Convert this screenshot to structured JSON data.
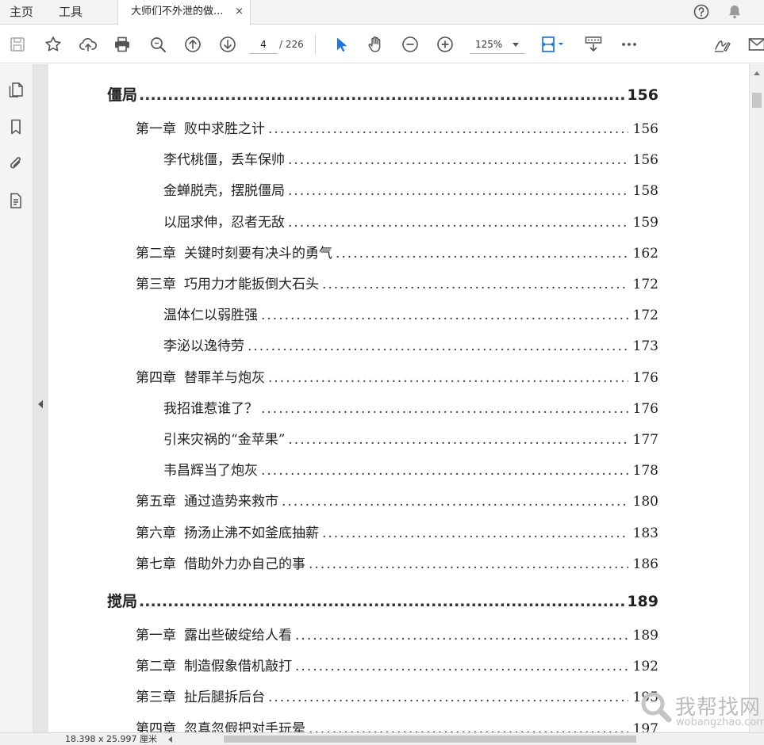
{
  "tabs": {
    "home": "主页",
    "tools": "工具",
    "document_title": "大师们不外泄的做...",
    "close_glyph": "×"
  },
  "toolbar": {
    "current_page": "4",
    "total_pages": "/ 226",
    "zoom": "125%",
    "icons": [
      "save-icon",
      "bookmark-star-icon",
      "cloud-upload-icon",
      "print-icon",
      "zoom-search-icon",
      "page-up-icon",
      "page-down-icon",
      "select-cursor-icon",
      "hand-tool-icon",
      "zoom-out-icon",
      "zoom-in-icon",
      "fit-page-icon",
      "scroll-mode-icon",
      "more-icon",
      "sign-icon",
      "mail-icon"
    ]
  },
  "left_rail": {
    "icons": [
      "page-thumbnails-icon",
      "bookmarks-icon",
      "attachments-icon",
      "document-properties-icon"
    ]
  },
  "toc": [
    {
      "level": "part",
      "title": "僵局",
      "page": "156"
    },
    {
      "level": "chapter",
      "chapter": "第一章",
      "title": "败中求胜之计",
      "page": "156"
    },
    {
      "level": "section",
      "title": "李代桃僵，丢车保帅",
      "page": "156"
    },
    {
      "level": "section",
      "title": "金蝉脱壳，摆脱僵局",
      "page": "158"
    },
    {
      "level": "section",
      "title": "以屈求伸，忍者无敌",
      "page": "159"
    },
    {
      "level": "chapter",
      "chapter": "第二章",
      "title": "关键时刻要有决斗的勇气",
      "page": "162"
    },
    {
      "level": "chapter",
      "chapter": "第三章",
      "title": "巧用力才能扳倒大石头",
      "page": "172"
    },
    {
      "level": "section",
      "title": "温体仁以弱胜强",
      "page": "172"
    },
    {
      "level": "section",
      "title": "李泌以逸待劳",
      "page": "173"
    },
    {
      "level": "chapter",
      "chapter": "第四章",
      "title": "替罪羊与炮灰",
      "page": "176"
    },
    {
      "level": "section",
      "title": "我招谁惹谁了？",
      "page": "176"
    },
    {
      "level": "section",
      "title": "引来灾祸的“金苹果”",
      "page": "177"
    },
    {
      "level": "section",
      "title": "韦昌辉当了炮灰",
      "page": "178"
    },
    {
      "level": "chapter",
      "chapter": "第五章",
      "title": "通过造势来救市",
      "page": "180"
    },
    {
      "level": "chapter",
      "chapter": "第六章",
      "title": "扬汤止沸不如釜底抽薪",
      "page": "183"
    },
    {
      "level": "chapter",
      "chapter": "第七章",
      "title": "借助外力办自己的事",
      "page": "186"
    },
    {
      "level": "part",
      "title": "搅局",
      "page": "189"
    },
    {
      "level": "chapter",
      "chapter": "第一章",
      "title": "露出些破绽给人看",
      "page": "189"
    },
    {
      "level": "chapter",
      "chapter": "第二章",
      "title": "制造假象借机敲打",
      "page": "192"
    },
    {
      "level": "chapter",
      "chapter": "第三章",
      "title": "扯后腿拆后台",
      "page": "195"
    },
    {
      "level": "chapter",
      "chapter": "第四章",
      "title": "忽真忽假把对手玩晕",
      "page": "197"
    }
  ],
  "status": {
    "page_size": "18.398 x 25.997 厘米"
  },
  "watermark": {
    "cn": "我帮找网",
    "en": "wobangzhao.com"
  },
  "colors": {
    "accent": "#1a73e8",
    "toolbar_icon": "#555555",
    "text": "#222222"
  }
}
